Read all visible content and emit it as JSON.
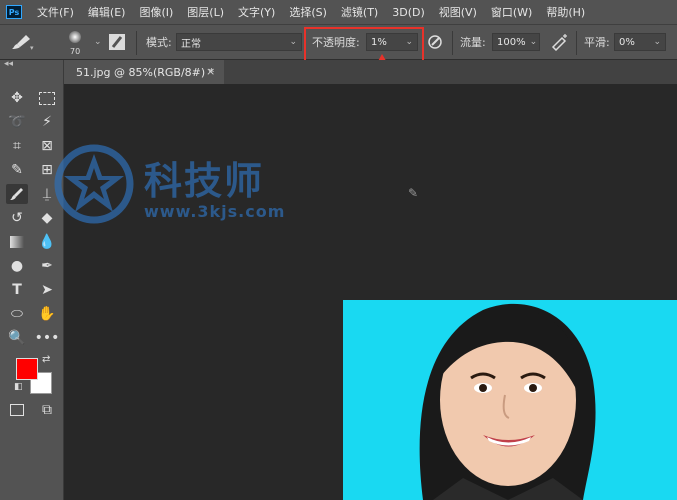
{
  "menubar": {
    "logo": "Ps",
    "items": [
      "文件(F)",
      "编辑(E)",
      "图像(I)",
      "图层(L)",
      "文字(Y)",
      "选择(S)",
      "滤镜(T)",
      "3D(D)",
      "视图(V)",
      "窗口(W)",
      "帮助(H)"
    ]
  },
  "options": {
    "brush_size": "70",
    "mode_label": "模式:",
    "mode_value": "正常",
    "opacity_label": "不透明度:",
    "opacity_value": "1%",
    "flow_label": "流量:",
    "flow_value": "100%",
    "smooth_label": "平滑:",
    "smooth_value": "0%"
  },
  "document": {
    "tab_title": "51.jpg @ 85%(RGB/8#) *",
    "close_glyph": "×"
  },
  "toolbar": {
    "collapse_glyph": "◂◂"
  },
  "watermark": {
    "title": "科技师",
    "url": "www.3kjs.com"
  },
  "colors": {
    "foreground": "#ff0000",
    "background": "#ffffff",
    "annotation": "#e8322a",
    "photo_bg": "#19d9f2"
  }
}
